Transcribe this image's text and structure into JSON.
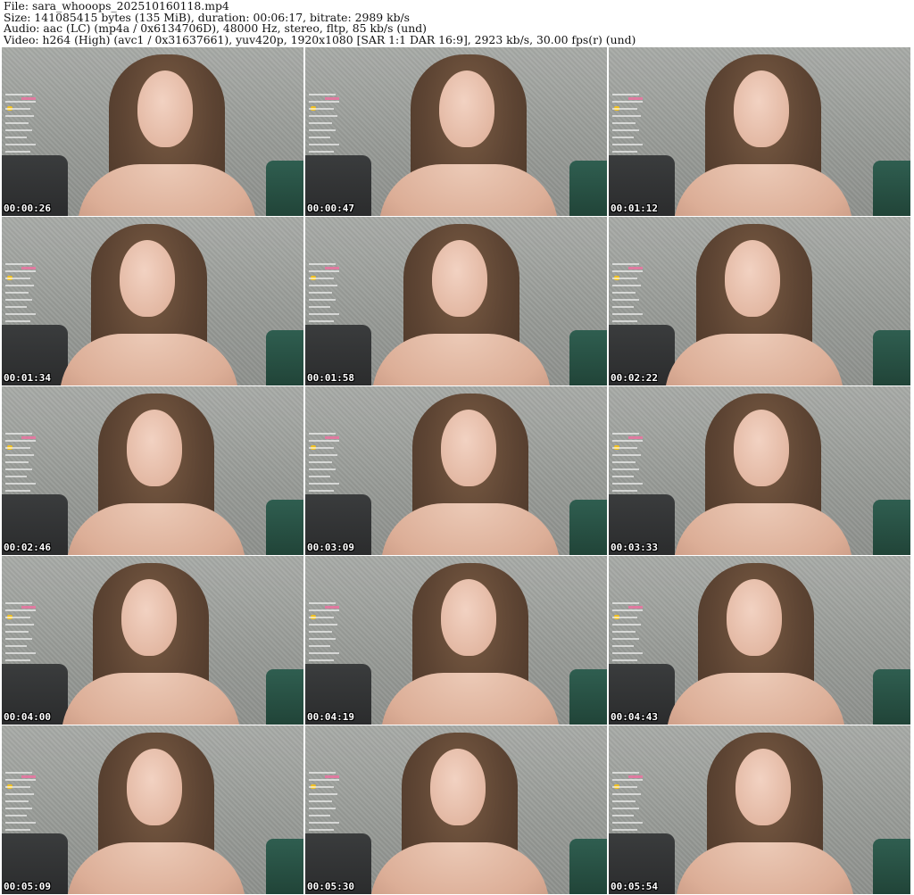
{
  "header": {
    "file_line": "File: sara_whooops_202510160118.mp4",
    "size_line": "Size: 141085415 bytes (135 MiB), duration: 00:06:17, bitrate: 2989 kb/s",
    "audio_line": "Audio: aac (LC) (mp4a / 0x6134706D), 48000 Hz, stereo, fltp, 85 kb/s (und)",
    "video_line": "Video: h264 (High) (avc1 / 0x31637661), yuv420p, 1920x1080 [SAR 1:1 DAR 16:9], 2923 kb/s, 30.00 fps(r) (und)"
  },
  "thumbnails": [
    {
      "timestamp": "00:00:26"
    },
    {
      "timestamp": "00:00:47"
    },
    {
      "timestamp": "00:01:12"
    },
    {
      "timestamp": "00:01:34"
    },
    {
      "timestamp": "00:01:58"
    },
    {
      "timestamp": "00:02:22"
    },
    {
      "timestamp": "00:02:46"
    },
    {
      "timestamp": "00:03:09"
    },
    {
      "timestamp": "00:03:33"
    },
    {
      "timestamp": "00:04:00"
    },
    {
      "timestamp": "00:04:19"
    },
    {
      "timestamp": "00:04:43"
    },
    {
      "timestamp": "00:05:09"
    },
    {
      "timestamp": "00:05:30"
    },
    {
      "timestamp": "00:05:54"
    }
  ]
}
